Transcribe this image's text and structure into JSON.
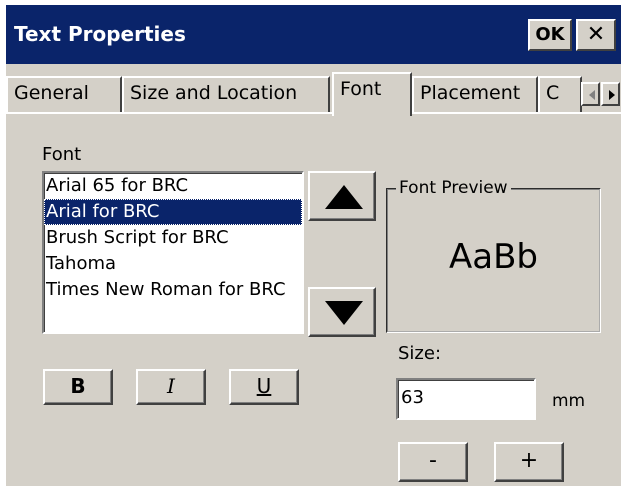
{
  "window": {
    "title": "Text Properties",
    "ok_label": "OK",
    "close_label": "✕"
  },
  "tabs": [
    {
      "label": "General",
      "active": false
    },
    {
      "label": "Size and Location",
      "active": false
    },
    {
      "label": "Font",
      "active": true
    },
    {
      "label": "Placement",
      "active": false
    },
    {
      "label": "C",
      "active": false
    }
  ],
  "font_section": {
    "label": "Font",
    "items": [
      "Arial 65 for BRC",
      "Arial for BRC",
      "Brush Script for BRC",
      "Tahoma",
      "Times New Roman for BRC"
    ],
    "selected": "Arial for BRC"
  },
  "style_buttons": {
    "bold": "B",
    "italic": "I",
    "underline": "U"
  },
  "preview": {
    "legend": "Font Preview",
    "sample": "AaBb"
  },
  "size": {
    "label": "Size:",
    "value": "63",
    "unit": "mm",
    "decrease": "-",
    "increase": "+"
  },
  "icons": {
    "scroll_up": "triangle-up-icon",
    "scroll_down": "triangle-down-icon",
    "tab_left": "tab-scroll-left-icon",
    "tab_right": "tab-scroll-right-icon"
  },
  "colors": {
    "title_bar": "#0a246a",
    "dialog_bg": "#d4d0c8",
    "selection": "#0a246a"
  }
}
